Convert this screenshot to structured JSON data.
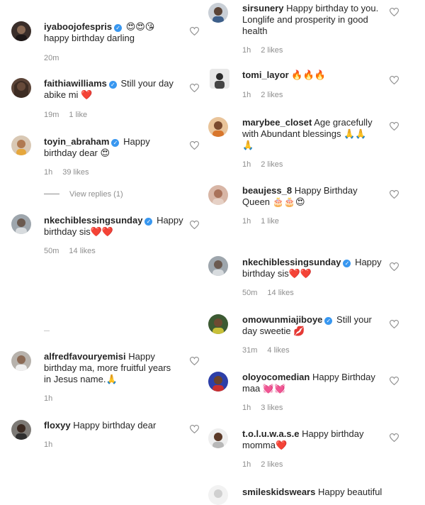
{
  "left": [
    {
      "username": "iyaboojofespris",
      "verified": true,
      "text": "",
      "text2": "happy birthday darling",
      "emoji": "😍😍😘",
      "time": "20m",
      "likes": ""
    },
    {
      "username": "faithiawilliams",
      "verified": true,
      "text": "Still your day",
      "text2": "abike mi",
      "emoji": "❤️",
      "time": "19m",
      "likes": "1 like"
    },
    {
      "username": "toyin_abraham",
      "verified": true,
      "text": "Happy",
      "text2": "birthday dear",
      "emoji": "😍",
      "time": "1h",
      "likes": "39 likes",
      "replies": "View replies (1)"
    },
    {
      "username": "nkechiblessingsunday",
      "verified": true,
      "text": "Happy",
      "text2": "birthday sis",
      "emoji": "❤️❤️",
      "time": "50m",
      "likes": "14 likes"
    },
    {
      "username": "alfredfavouryemisi",
      "verified": false,
      "text": "Happy",
      "text2": "birthday ma, more fruitful years",
      "text3": "in Jesus name.",
      "emoji": "🙏",
      "time": "1h",
      "likes": ""
    },
    {
      "username": "floxyy",
      "verified": false,
      "text": "Happy birthday dear",
      "time": "1h",
      "likes": ""
    }
  ],
  "right": [
    {
      "username": "sirsunery",
      "verified": false,
      "text": "Happy birthday to you.",
      "text2": "Longlife and prosperity in good",
      "text3": "health",
      "time": "1h",
      "likes": "2 likes"
    },
    {
      "username": "tomi_layor",
      "verified": false,
      "text": "",
      "emoji": "🔥🔥🔥",
      "time": "1h",
      "likes": "2 likes"
    },
    {
      "username": "marybee_closet",
      "verified": false,
      "text": "Age gracefully",
      "text2": "with Abundant blessings",
      "emoji": "🙏🙏",
      "emoji3": "🙏",
      "time": "1h",
      "likes": "2 likes"
    },
    {
      "username": "beaujess_8",
      "verified": false,
      "text": "Happy Birthday",
      "text2": "Queen",
      "emoji": "🎂🎂😍",
      "time": "1h",
      "likes": "1 like"
    },
    {
      "username": "nkechiblessingsunday",
      "verified": true,
      "text": "Happy",
      "text2": "birthday sis",
      "emoji": "❤️❤️",
      "time": "50m",
      "likes": "14 likes"
    },
    {
      "username": "omowunmiajiboye",
      "verified": true,
      "text": "Still your",
      "text2": "day sweetie",
      "emoji": "💋",
      "time": "31m",
      "likes": "4 likes"
    },
    {
      "username": "oloyocomedian",
      "verified": false,
      "text": "Happy Birthday",
      "text2": "maa",
      "emoji": "💓💓",
      "time": "1h",
      "likes": "3 likes"
    },
    {
      "username": "t.o.l.u.w.a.s.e",
      "verified": false,
      "text": "Happy birthday",
      "text2": "momma",
      "emoji": "❤️",
      "time": "1h",
      "likes": "2 likes"
    },
    {
      "username": "smileskidswears",
      "verified": false,
      "text": "Happy beautiful",
      "time": "",
      "likes": ""
    }
  ]
}
